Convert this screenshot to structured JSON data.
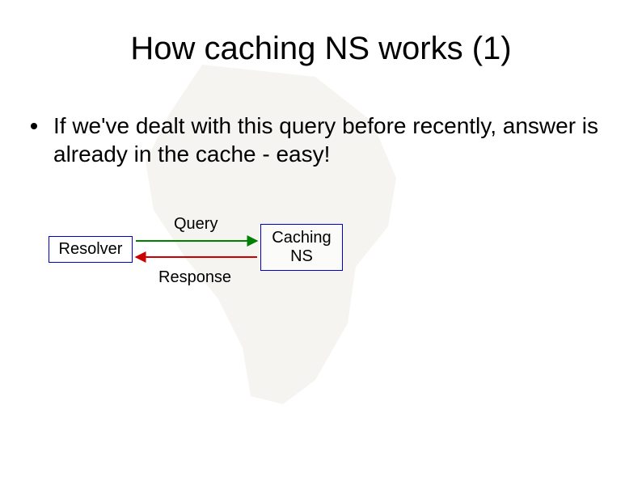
{
  "title": "How caching NS works (1)",
  "bullet": "If we've dealt with this query before recently, answer is already in the cache - easy!",
  "diagram": {
    "resolver": "Resolver",
    "caching": "Caching\nNS",
    "query": "Query",
    "response": "Response"
  }
}
